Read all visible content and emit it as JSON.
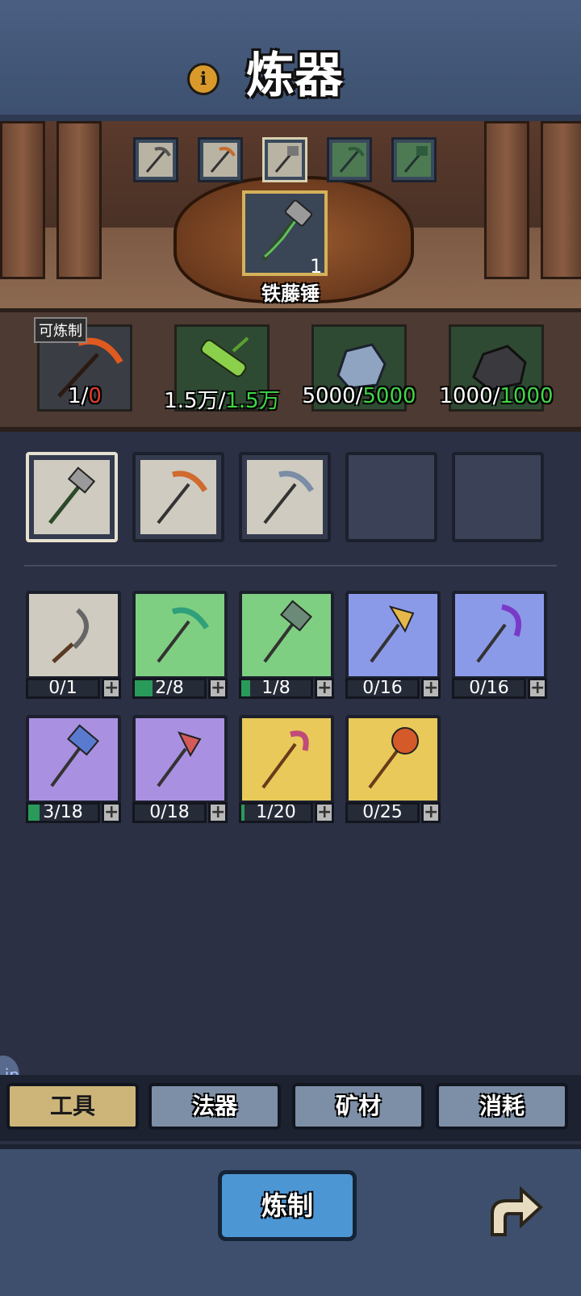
{
  "header": {
    "title": "炼器",
    "info_icon": "info-icon"
  },
  "forge": {
    "top_thumbnails": [
      {
        "icon": "pickaxe-icon",
        "tint": "grey"
      },
      {
        "icon": "pickaxe-icon",
        "tint": "grey"
      },
      {
        "icon": "hammer-icon",
        "tint": "grey",
        "selected": true
      },
      {
        "icon": "pickaxe-icon",
        "tint": "green"
      },
      {
        "icon": "hammer-icon",
        "tint": "green"
      }
    ],
    "selected_item": {
      "name": "铁藤锤",
      "count": "1",
      "icon": "vine-hammer-icon"
    }
  },
  "materials": {
    "craftable_badge": "可炼制",
    "items": [
      {
        "icon": "fire-pickaxe-icon",
        "have": "1",
        "sep": "/",
        "need": "0",
        "need_color": "#e53a2a"
      },
      {
        "icon": "bamboo-icon",
        "have": "1.5万",
        "sep": "/",
        "need": "1.5万",
        "need_color": "#3fd644"
      },
      {
        "icon": "iron-ore-icon",
        "have": "5000",
        "sep": "/",
        "need": "5000",
        "need_color": "#3fd644"
      },
      {
        "icon": "coal-icon",
        "have": "1000",
        "sep": "/",
        "need": "1000",
        "need_color": "#3fd644"
      }
    ]
  },
  "queue_slots": [
    {
      "icon": "vine-hammer-icon",
      "selected": true
    },
    {
      "icon": "copper-pickaxe-icon"
    },
    {
      "icon": "iron-pickaxe-icon"
    },
    {
      "empty": true
    },
    {
      "empty": true
    }
  ],
  "inventory": [
    {
      "icon": "sickle-icon",
      "rarity": "grey",
      "progress": "0/1",
      "fill": 0
    },
    {
      "icon": "jade-pickaxe-icon",
      "rarity": "green",
      "progress": "2/8",
      "fill": 0.25
    },
    {
      "icon": "jade-hammer-icon",
      "rarity": "green",
      "progress": "1/8",
      "fill": 0.125
    },
    {
      "icon": "golden-axe-icon",
      "rarity": "blue",
      "progress": "0/16",
      "fill": 0
    },
    {
      "icon": "purple-pick-icon",
      "rarity": "blue",
      "progress": "0/16",
      "fill": 0
    },
    {
      "icon": "crystal-hammer-icon",
      "rarity": "purple",
      "progress": "3/18",
      "fill": 0.167
    },
    {
      "icon": "flame-axe-icon",
      "rarity": "purple",
      "progress": "0/18",
      "fill": 0
    },
    {
      "icon": "gold-staff-icon",
      "rarity": "gold",
      "progress": "1/20",
      "fill": 0.05
    },
    {
      "icon": "lion-mace-icon",
      "rarity": "gold",
      "progress": "0/25",
      "fill": 0
    }
  ],
  "tabs": [
    {
      "label": "工具",
      "active": true
    },
    {
      "label": "法器"
    },
    {
      "label": "矿材"
    },
    {
      "label": "消耗"
    }
  ],
  "footer": {
    "craft_label": "炼制",
    "back_icon": "return-arrow-icon",
    "side_tab": "ip"
  },
  "colors": {
    "accent_gold": "#d4b15a",
    "craft_blue": "#4d96d4",
    "ok_green": "#3fd644",
    "warn_red": "#e53a2a"
  }
}
